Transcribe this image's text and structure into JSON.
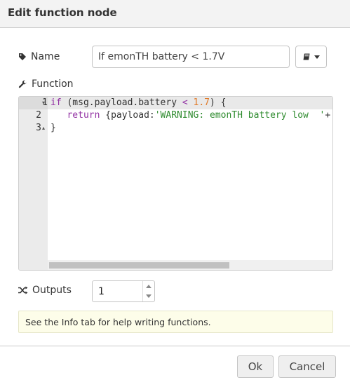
{
  "dialog": {
    "title": "Edit function node"
  },
  "fields": {
    "name_label": "Name",
    "name_value": "If emonTH battery < 1.7V",
    "function_label": "Function",
    "outputs_label": "Outputs",
    "outputs_value": "1"
  },
  "editor": {
    "line_numbers": [
      "1",
      "2",
      "3"
    ],
    "lines": [
      [
        {
          "t": "if",
          "c": "kw"
        },
        {
          "t": " (msg.payload.battery ",
          "c": "plain"
        },
        {
          "t": "<",
          "c": "op"
        },
        {
          "t": " ",
          "c": "plain"
        },
        {
          "t": "1.7",
          "c": "num"
        },
        {
          "t": ") {",
          "c": "plain"
        }
      ],
      [
        {
          "t": "   return ",
          "c": "kw"
        },
        {
          "t": "{payload:",
          "c": "plain"
        },
        {
          "t": "'WARNING: emonTH battery low  '",
          "c": "str"
        },
        {
          "t": "+",
          "c": "plain"
        }
      ],
      [
        {
          "t": "}",
          "c": "plain"
        }
      ]
    ]
  },
  "tip": {
    "text": "See the Info tab for help writing functions."
  },
  "buttons": {
    "ok": "Ok",
    "cancel": "Cancel"
  },
  "colors": {
    "keyword": "#9333a4",
    "number": "#e07a29",
    "string": "#2e8b2e",
    "tip_bg": "#fdfde9"
  }
}
